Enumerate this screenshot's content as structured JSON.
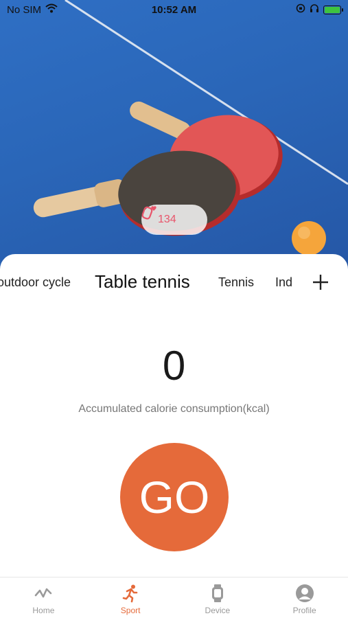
{
  "status_bar": {
    "carrier": "No SIM",
    "time": "10:52 AM"
  },
  "hero": {
    "heart_rate": "134"
  },
  "sport_tabs": {
    "items": [
      "outdoor cycle",
      "Table tennis",
      "Tennis",
      "Ind"
    ],
    "selected": "Table tennis"
  },
  "calories": {
    "value": "0",
    "label": "Accumulated calorie consumption(kcal)"
  },
  "go_button": {
    "label": "GO"
  },
  "bottom_nav": {
    "items": [
      {
        "label": "Home",
        "icon": "home-wave-icon"
      },
      {
        "label": "Sport",
        "icon": "running-person-icon"
      },
      {
        "label": "Device",
        "icon": "watch-icon"
      },
      {
        "label": "Profile",
        "icon": "person-icon"
      }
    ],
    "active": "Sport"
  },
  "colors": {
    "accent": "#e56a3a",
    "table_blue": "#2a66b8",
    "heart_rate": "#e8556b",
    "battery": "#3ec43e"
  }
}
